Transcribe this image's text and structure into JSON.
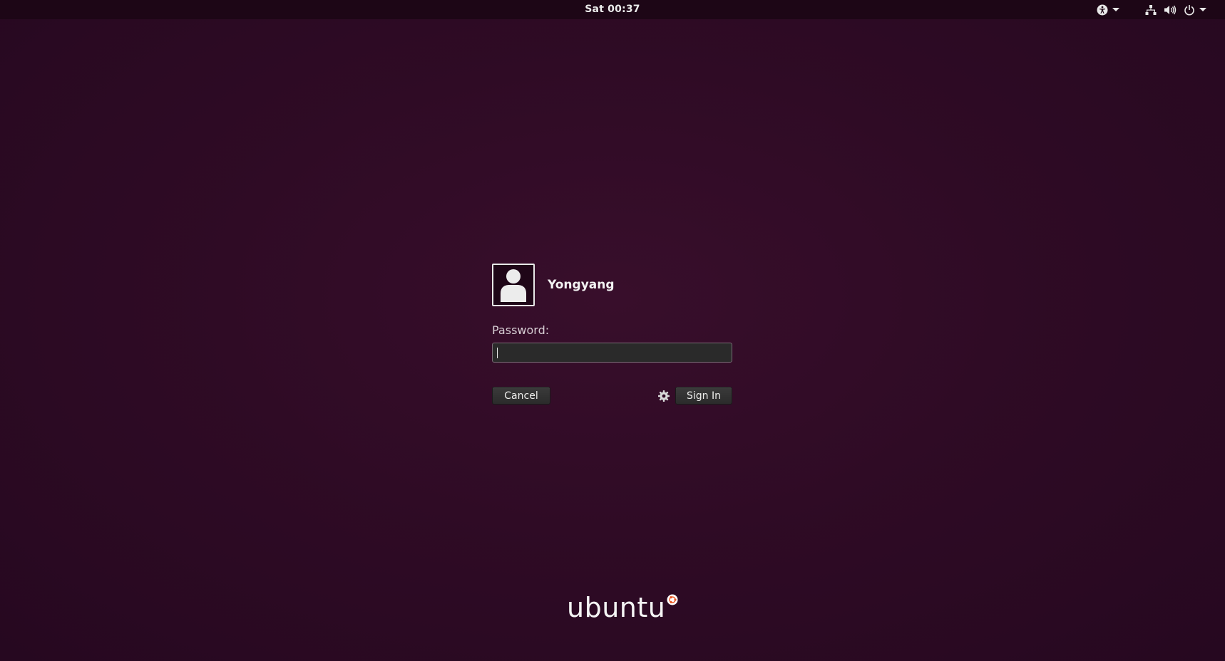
{
  "topbar": {
    "clock": "Sat 00:37",
    "icons": [
      "accessibility-icon",
      "network-icon",
      "volume-icon",
      "power-icon"
    ]
  },
  "login": {
    "username": "Yongyang",
    "password_label": "Password:",
    "password_value": "",
    "cancel_label": "Cancel",
    "signin_label": "Sign In",
    "session_icon": "gear-icon"
  },
  "branding": {
    "logo_text": "ubuntu"
  },
  "colors": {
    "background": "#2c0a21",
    "topbar": "#1d0616",
    "accent": "#e95420"
  }
}
